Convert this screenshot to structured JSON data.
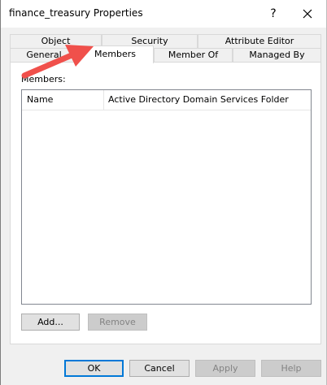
{
  "window": {
    "title": "finance_treasury Properties",
    "help_glyph": "?"
  },
  "tabs": {
    "row1": [
      {
        "label": "Object"
      },
      {
        "label": "Security"
      },
      {
        "label": "Attribute Editor"
      }
    ],
    "row2": [
      {
        "label": "General"
      },
      {
        "label": "Members"
      },
      {
        "label": "Member Of"
      },
      {
        "label": "Managed By"
      }
    ],
    "active": "Members"
  },
  "members_panel": {
    "label": "Members:",
    "columns": [
      "Name",
      "Active Directory Domain Services Folder"
    ],
    "rows": [],
    "add_label": "Add...",
    "remove_label": "Remove"
  },
  "footer": {
    "ok_label": "OK",
    "cancel_label": "Cancel",
    "apply_label": "Apply",
    "help_label": "Help"
  },
  "colors": {
    "annotation_arrow": "#f0504b",
    "default_button_border": "#0078d7"
  },
  "icons": [
    "close-icon",
    "annotation-arrow-icon"
  ]
}
